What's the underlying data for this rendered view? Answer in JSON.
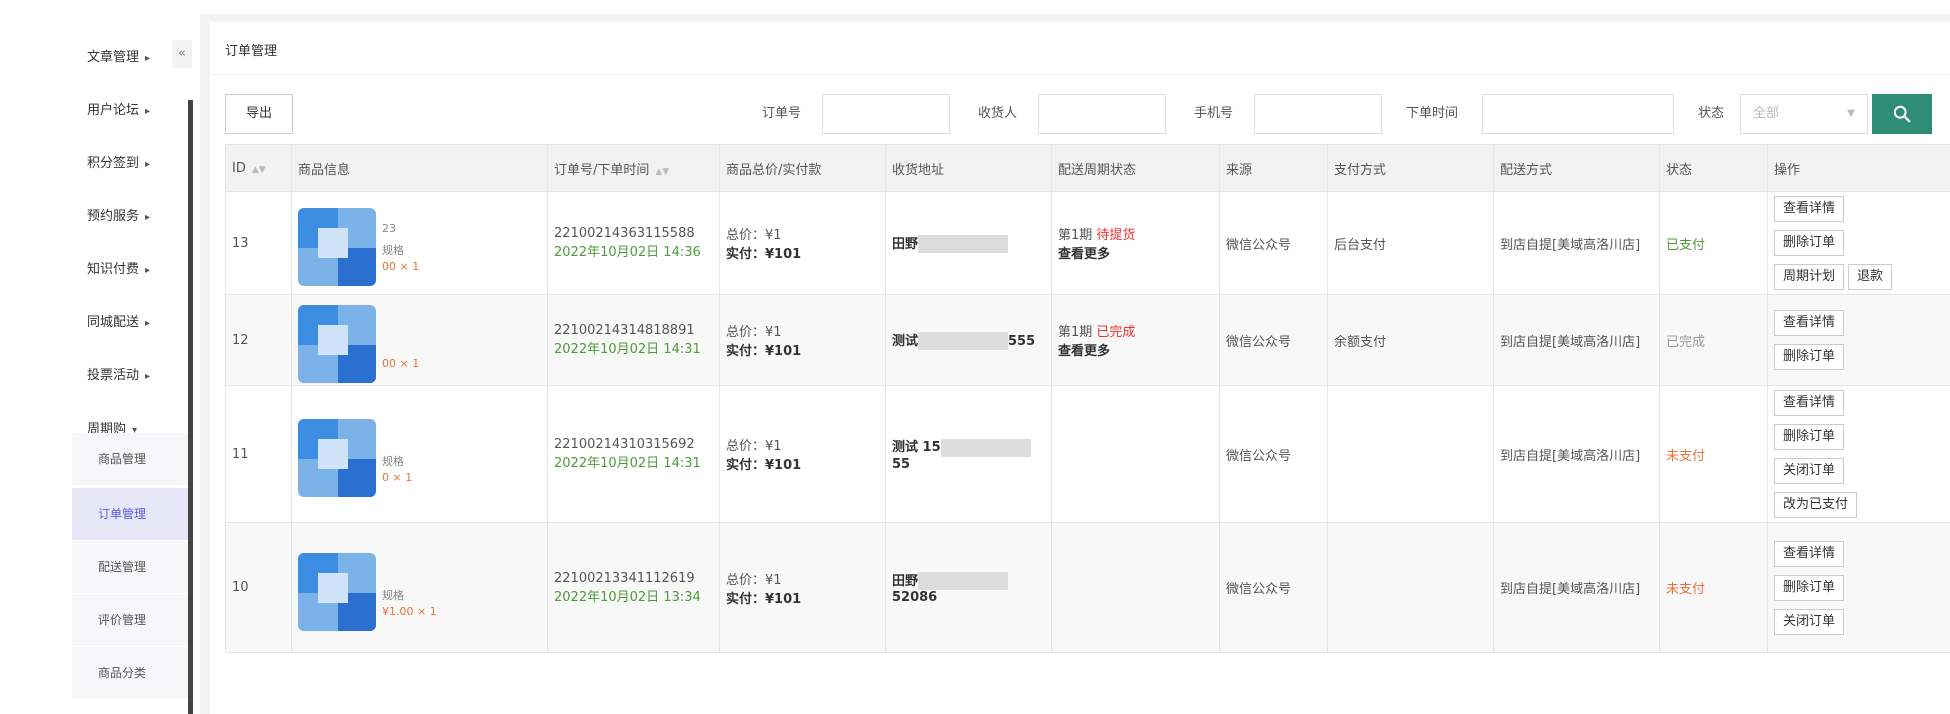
{
  "sidebar": {
    "collapse_glyph": "«",
    "items": [
      {
        "label": "文章管理",
        "caret": "▸"
      },
      {
        "label": "用户论坛",
        "caret": "▸"
      },
      {
        "label": "积分签到",
        "caret": "▸"
      },
      {
        "label": "预约服务",
        "caret": "▸"
      },
      {
        "label": "知识付费",
        "caret": "▸"
      },
      {
        "label": "同城配送",
        "caret": "▸"
      },
      {
        "label": "投票活动",
        "caret": "▸"
      },
      {
        "label": "周期购",
        "caret": "▾"
      }
    ],
    "subitems": [
      {
        "label": "商品管理"
      },
      {
        "label": "订单管理",
        "active": true
      },
      {
        "label": "配送管理"
      },
      {
        "label": "评价管理"
      },
      {
        "label": "商品分类"
      }
    ]
  },
  "page": {
    "title": "订单管理"
  },
  "toolbar": {
    "export_label": "导出",
    "order_no_label": "订单号",
    "receiver_label": "收货人",
    "phone_label": "手机号",
    "order_time_label": "下单时间",
    "status_label": "状态",
    "status_value": "全部",
    "search_icon": "search-icon"
  },
  "table": {
    "headers": [
      "ID",
      "商品信息",
      "订单号/下单时间",
      "商品总价/实付款",
      "收货地址",
      "配送周期状态",
      "来源",
      "支付方式",
      "配送方式",
      "状态",
      "操作"
    ],
    "rows": [
      {
        "id": "13",
        "spec_num": "23",
        "spec": "规格",
        "price": "00 × 1",
        "order_no": "22100214363115588",
        "order_time": "2022年10月02日 14:36",
        "total_label": "总价：",
        "total": "¥1",
        "paid_label": "实付：",
        "paid": "¥101",
        "addr_prefix": "田野",
        "addr_suffix": "",
        "period": "第1期",
        "period_status": "待提货",
        "period_more": "查看更多",
        "source": "微信公众号",
        "pay_method": "后台支付",
        "delivery": "到店自提[美域高洛川店]",
        "status": "已支付",
        "status_color": "#4d9b3c",
        "actions": [
          "查看详情",
          "删除订单",
          "周期计划",
          "退款"
        ]
      },
      {
        "id": "12",
        "spec": "",
        "price": "00 × 1",
        "order_no": "22100214314818891",
        "order_time": "2022年10月02日 14:31",
        "total_label": "总价：",
        "total": "¥1",
        "paid_label": "实付：",
        "paid": "¥101",
        "addr_prefix": "测试",
        "addr_suffix": "555",
        "period": "第1期",
        "period_status": "已完成",
        "period_more": "查看更多",
        "source": "微信公众号",
        "pay_method": "余额支付",
        "delivery": "到店自提[美域高洛川店]",
        "status": "已完成",
        "status_color": "#999999",
        "actions": [
          "查看详情",
          "删除订单"
        ]
      },
      {
        "id": "11",
        "spec": "规格",
        "price": "0 × 1",
        "order_no": "22100214310315692",
        "order_time": "2022年10月02日 14:31",
        "total_label": "总价：",
        "total": "¥1",
        "paid_label": "实付：",
        "paid": "¥101",
        "addr_prefix": "测试 15",
        "addr_suffix": "55",
        "period": "",
        "period_status": "",
        "period_more": "",
        "source": "微信公众号",
        "pay_method": "",
        "delivery": "到店自提[美域高洛川店]",
        "status": "未支付",
        "status_color": "#e8733a",
        "actions": [
          "查看详情",
          "删除订单",
          "关闭订单",
          "改为已支付"
        ]
      },
      {
        "id": "10",
        "spec": "规格",
        "price": "¥1.00 × 1",
        "order_no": "22100213341112619",
        "order_time": "2022年10月02日 13:34",
        "total_label": "总价：",
        "total": "¥1",
        "paid_label": "实付：",
        "paid": "¥101",
        "addr_prefix": "田野",
        "addr_suffix": "52086",
        "period": "",
        "period_status": "",
        "period_more": "",
        "source": "微信公众号",
        "pay_method": "",
        "delivery": "到店自提[美域高洛川店]",
        "status": "未支付",
        "status_color": "#e8733a",
        "actions": [
          "查看详情",
          "删除订单",
          "关闭订单"
        ]
      }
    ]
  }
}
